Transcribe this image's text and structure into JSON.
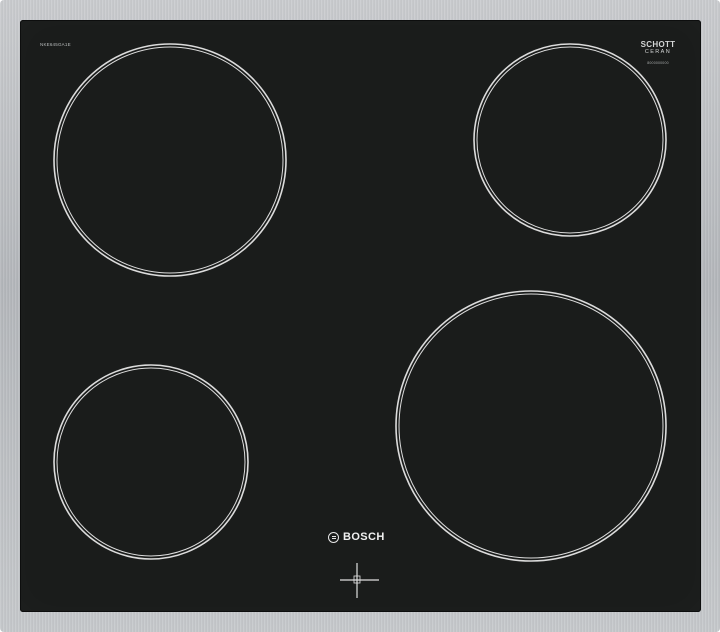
{
  "product": {
    "model_code": "NKE645GA1E",
    "glass_brand_line1": "SCHOTT",
    "glass_brand_line2": "CERAN",
    "glass_code": "8000000000",
    "brand_name": "BOSCH"
  },
  "cooking_zones": [
    {
      "name": "rear-left-zone",
      "position": "rear-left",
      "size": "large"
    },
    {
      "name": "rear-right-zone",
      "position": "rear-right",
      "size": "small"
    },
    {
      "name": "front-left-zone",
      "position": "front-left",
      "size": "medium"
    },
    {
      "name": "front-right-zone",
      "position": "front-right",
      "size": "large"
    }
  ],
  "colors": {
    "glass": "#1a1c1b",
    "zone_outline": "#dcdcdc",
    "frame": "#bdbfc2",
    "text": "#f0f0f0"
  },
  "icons": [
    "bosch-logo-icon",
    "zone-position-icon"
  ]
}
